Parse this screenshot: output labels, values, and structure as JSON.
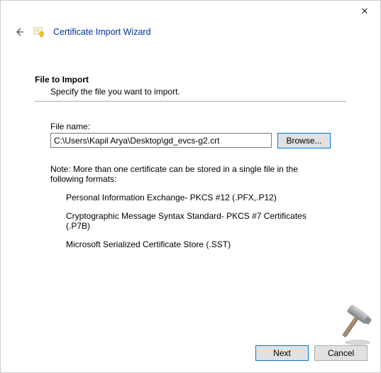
{
  "window": {
    "close_label": "✕"
  },
  "header": {
    "title": "Certificate Import Wizard"
  },
  "section": {
    "title": "File to Import",
    "description": "Specify the file you want to import."
  },
  "file": {
    "label": "File name:",
    "value": "C:\\Users\\Kapil Arya\\Desktop\\gd_evcs-g2.crt",
    "browse_label": "Browse..."
  },
  "note": {
    "text": "Note:  More than one certificate can be stored in a single file in the following formats:",
    "formats": [
      "Personal Information Exchange- PKCS #12 (.PFX,.P12)",
      "Cryptographic Message Syntax Standard- PKCS #7 Certificates (.P7B)",
      "Microsoft Serialized Certificate Store (.SST)"
    ]
  },
  "footer": {
    "next_label": "Next",
    "cancel_label": "Cancel"
  }
}
